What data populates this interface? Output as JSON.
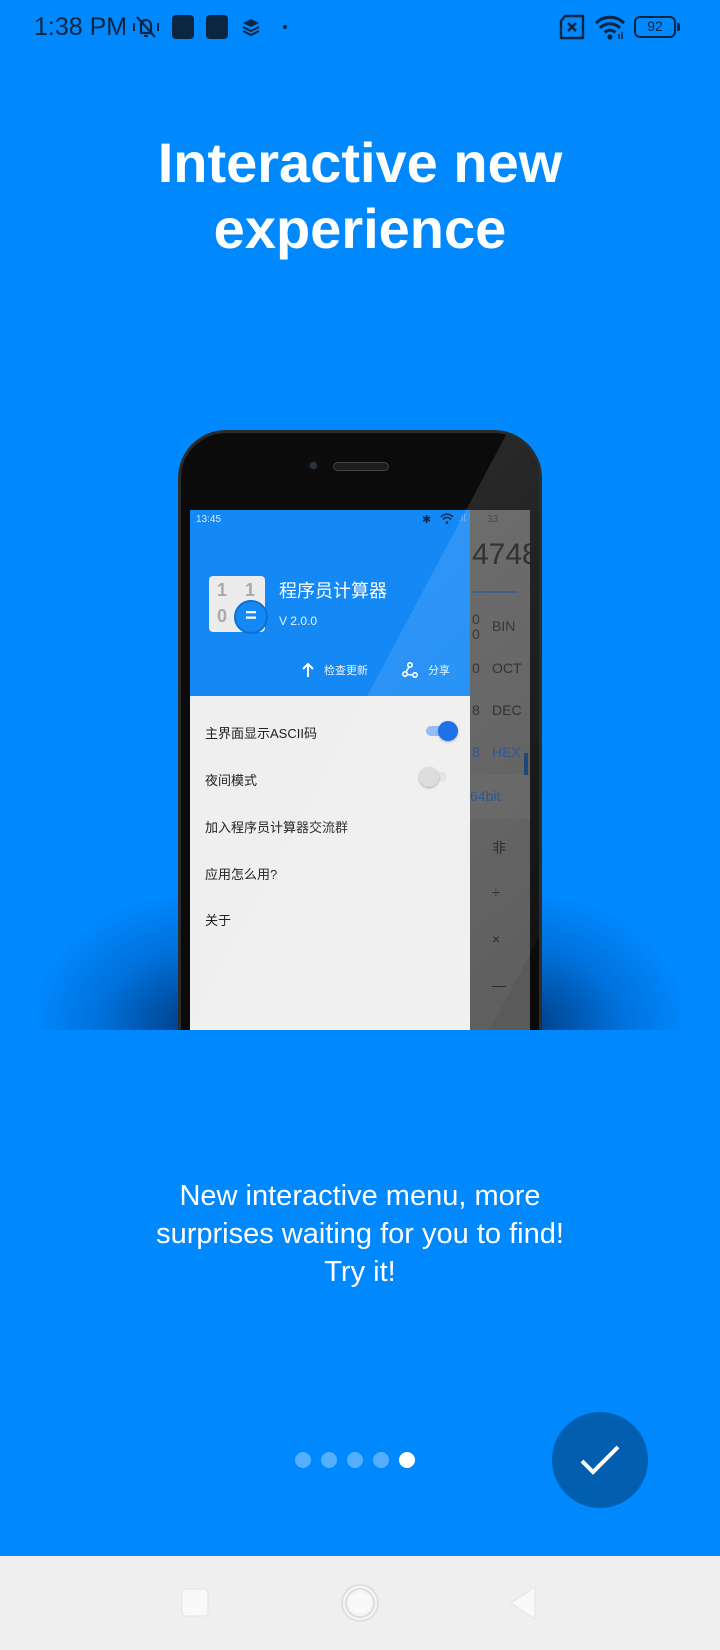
{
  "status_bar": {
    "time": "1:38 PM",
    "icons": [
      "mute-vibrate-icon",
      "app-notification-icon",
      "app-notification-icon",
      "layers-icon",
      "dot-icon",
      "no-sim-icon",
      "wifi-icon",
      "battery-icon"
    ],
    "battery": "92"
  },
  "onboarding": {
    "title_line1": "Interactive new",
    "title_line2": "experience",
    "description_line1": "New interactive menu, more",
    "description_line2": "surprises waiting for you to find!",
    "description_line3": "Try it!",
    "page_count": 5,
    "current_page": 5,
    "done_icon": "check-icon"
  },
  "mockup": {
    "status_time": "13:45",
    "status_battery": "33",
    "app_name": "程序员计算器",
    "app_version": "V 2.0.0",
    "logo_digits": [
      "1",
      "1",
      "0"
    ],
    "logo_symbol": "=",
    "header_actions": [
      {
        "label": "检查更新",
        "icon": "arrow-up-icon"
      },
      {
        "label": "分享",
        "icon": "share-icon"
      }
    ],
    "menu": [
      {
        "label": "主界面显示ASCII码",
        "toggle": true
      },
      {
        "label": "夜间模式",
        "toggle": false
      },
      {
        "label": "加入程序员计算器交流群"
      },
      {
        "label": "应用怎么用?"
      },
      {
        "label": "关于"
      }
    ],
    "background_app": {
      "display_value": "4748",
      "rows": [
        {
          "digit": "0\n0",
          "label": "BIN"
        },
        {
          "digit": "0",
          "label": "OCT"
        },
        {
          "digit": "8",
          "label": "DEC"
        },
        {
          "digit": "8",
          "label": "HEX"
        }
      ],
      "word_size": "64bit",
      "keys": [
        "非",
        "÷",
        "×",
        "—"
      ]
    }
  },
  "nav_bar": {
    "buttons": [
      "recent-apps",
      "home",
      "back"
    ]
  }
}
